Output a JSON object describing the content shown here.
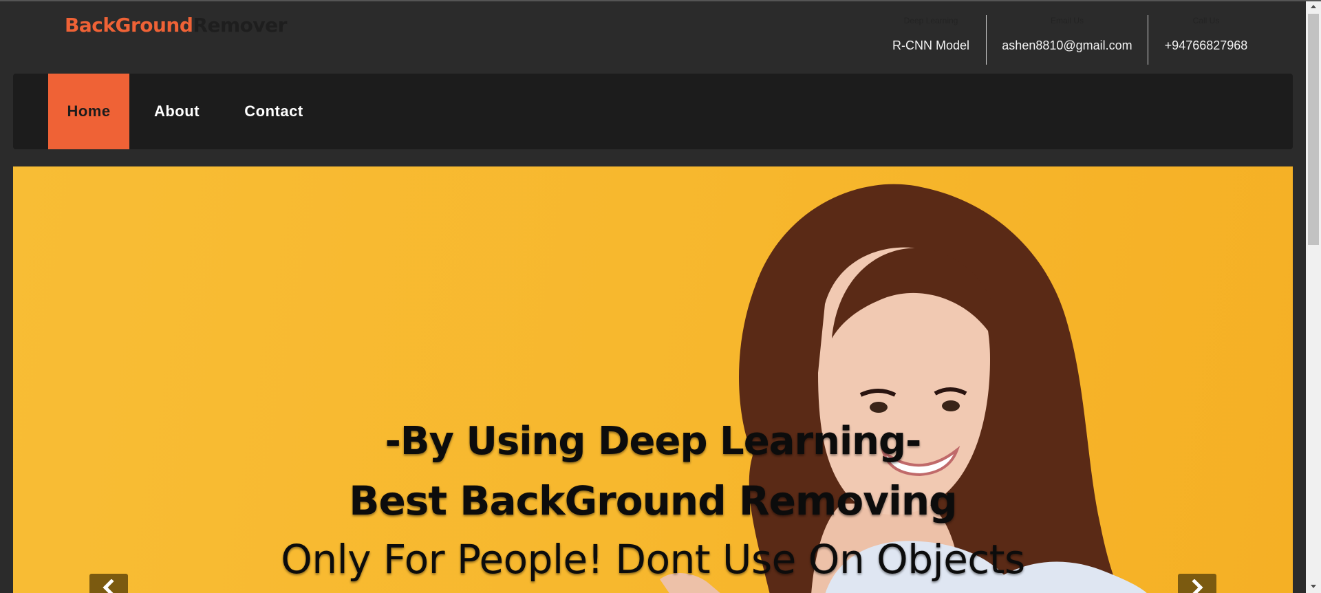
{
  "brand": {
    "part1": "BackGround",
    "part2": "Remover",
    "colors": {
      "accent": "#ef6236",
      "dark": "#1e1e1e"
    }
  },
  "header_info": [
    {
      "caption": "Deep Learning",
      "value": "R-CNN Model"
    },
    {
      "caption": "Email Us",
      "value": "ashen8810@gmail.com"
    },
    {
      "caption": "Call Us",
      "value": "+94766827968"
    }
  ],
  "nav": {
    "items": [
      {
        "label": "Home",
        "active": true
      },
      {
        "label": "About"
      },
      {
        "label": "Contact"
      }
    ]
  },
  "hero": {
    "line1": "-By Using Deep Learning-",
    "line2": "Best BackGround Removing",
    "line3": "Only For People! Dont Use On Objects",
    "background_color": "#f8bd35",
    "prev_icon": "chevron-left-icon",
    "next_icon": "chevron-right-icon"
  },
  "scrollbar": {
    "up_icon": "triangle-up-icon",
    "down_icon": "triangle-down-icon"
  }
}
